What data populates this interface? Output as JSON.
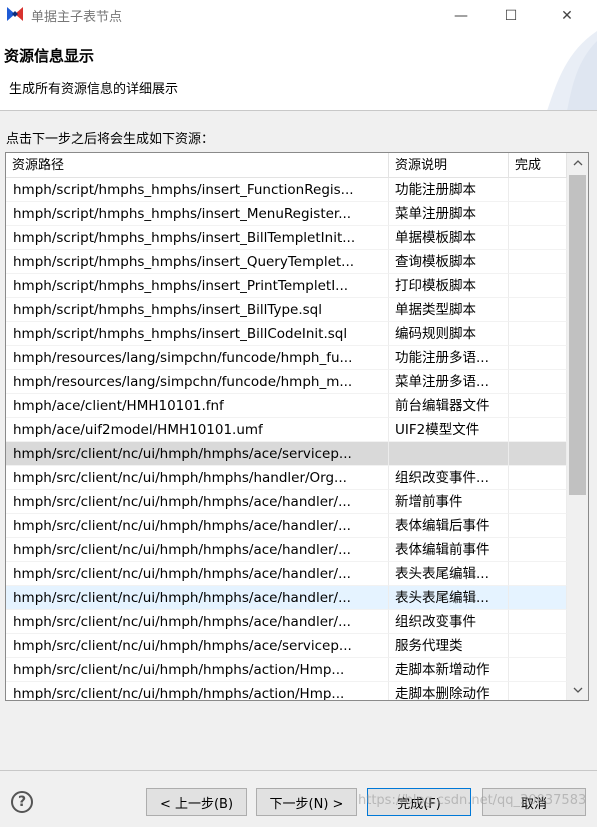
{
  "window": {
    "title": "单据主子表节点",
    "minimize_glyph": "—",
    "maximize_glyph": "☐",
    "close_glyph": "✕"
  },
  "banner": {
    "title": "资源信息显示",
    "description": "生成所有资源信息的详细展示"
  },
  "main": {
    "prompt": "点击下一步之后将会生成如下资源："
  },
  "table": {
    "columns": [
      "资源路径",
      "资源说明",
      "完成"
    ],
    "rows": [
      {
        "path": "hmph/script/hmphs_hmphs/insert_FunctionRegis...",
        "desc": "功能注册脚本",
        "done": ""
      },
      {
        "path": "hmph/script/hmphs_hmphs/insert_MenuRegister...",
        "desc": "菜单注册脚本",
        "done": ""
      },
      {
        "path": "hmph/script/hmphs_hmphs/insert_BillTempletInit...",
        "desc": "单据模板脚本",
        "done": ""
      },
      {
        "path": "hmph/script/hmphs_hmphs/insert_QueryTemplet...",
        "desc": "查询模板脚本",
        "done": ""
      },
      {
        "path": "hmph/script/hmphs_hmphs/insert_PrintTempletI...",
        "desc": "打印模板脚本",
        "done": ""
      },
      {
        "path": "hmph/script/hmphs_hmphs/insert_BillType.sql",
        "desc": "单据类型脚本",
        "done": ""
      },
      {
        "path": "hmph/script/hmphs_hmphs/insert_BillCodeInit.sql",
        "desc": "编码规则脚本",
        "done": ""
      },
      {
        "path": "hmph/resources/lang/simpchn/funcode/hmph_fu...",
        "desc": "功能注册多语...",
        "done": ""
      },
      {
        "path": "hmph/resources/lang/simpchn/funcode/hmph_m...",
        "desc": "菜单注册多语...",
        "done": ""
      },
      {
        "path": "hmph/ace/client/HMH10101.fnf",
        "desc": "前台编辑器文件",
        "done": ""
      },
      {
        "path": "hmph/ace/uif2model/HMH10101.umf",
        "desc": "UIF2模型文件",
        "done": ""
      },
      {
        "path": "hmph/src/client/nc/ui/hmph/hmphs/ace/servicep...",
        "desc": "",
        "done": ""
      },
      {
        "path": "hmph/src/client/nc/ui/hmph/hmphs/handler/Org...",
        "desc": "组织改变事件...",
        "done": ""
      },
      {
        "path": "hmph/src/client/nc/ui/hmph/hmphs/ace/handler/...",
        "desc": "新增前事件",
        "done": ""
      },
      {
        "path": "hmph/src/client/nc/ui/hmph/hmphs/ace/handler/...",
        "desc": "表体编辑后事件",
        "done": ""
      },
      {
        "path": "hmph/src/client/nc/ui/hmph/hmphs/ace/handler/...",
        "desc": "表体编辑前事件",
        "done": ""
      },
      {
        "path": "hmph/src/client/nc/ui/hmph/hmphs/ace/handler/...",
        "desc": "表头表尾编辑...",
        "done": ""
      },
      {
        "path": "hmph/src/client/nc/ui/hmph/hmphs/ace/handler/...",
        "desc": "表头表尾编辑...",
        "done": ""
      },
      {
        "path": "hmph/src/client/nc/ui/hmph/hmphs/ace/handler/...",
        "desc": "组织改变事件",
        "done": ""
      },
      {
        "path": "hmph/src/client/nc/ui/hmph/hmphs/ace/servicep...",
        "desc": "服务代理类",
        "done": ""
      },
      {
        "path": "hmph/src/client/nc/ui/hmph/hmphs/action/Hmp...",
        "desc": "走脚本新增动作",
        "done": ""
      },
      {
        "path": "hmph/src/client/nc/ui/hmph/hmphs/action/Hmp...",
        "desc": "走脚本删除动作",
        "done": ""
      }
    ],
    "selected_index": 11,
    "hover_index": 17
  },
  "buttons": {
    "help": "?",
    "back": "< 上一步(B)",
    "next": "下一步(N) >",
    "finish": "完成(F)",
    "cancel": "取消"
  },
  "watermark": "https://blog.csdn.net/qq_30037583",
  "icons": {
    "app": "app-logo-icon",
    "help": "help-icon",
    "scroll_up": "chevron-up-icon",
    "scroll_down": "chevron-down-icon"
  },
  "colors": {
    "selected_row": "#d9d9d9",
    "hover_row": "#e5f3ff",
    "default_button_border": "#0078d7",
    "logo_blue": "#1e5bd6",
    "logo_red": "#d8322e"
  }
}
